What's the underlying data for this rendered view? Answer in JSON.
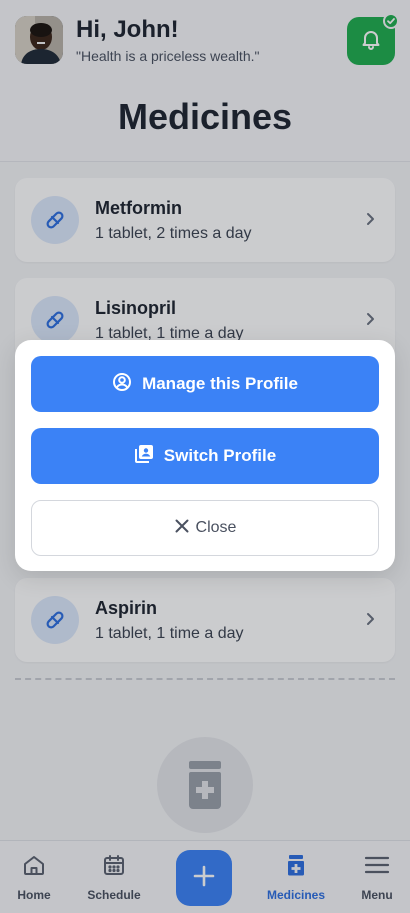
{
  "header": {
    "greeting": "Hi, John!",
    "quote": "\"Health is a priceless wealth.\"",
    "title": "Medicines"
  },
  "medicines": [
    {
      "name": "Metformin",
      "dose": "1 tablet, 2 times a day"
    },
    {
      "name": "Lisinopril",
      "dose": "1 tablet, 1 time a day"
    },
    {
      "name": "Aspirin",
      "dose": "1 tablet, 1 time a day"
    }
  ],
  "modal": {
    "manage_label": "Manage this Profile",
    "switch_label": "Switch Profile",
    "close_label": "Close"
  },
  "nav": {
    "home": "Home",
    "schedule": "Schedule",
    "medicines": "Medicines",
    "menu": "Menu"
  },
  "colors": {
    "accent": "#3b82f6",
    "bell_bg": "#1fae4f",
    "active_nav": "#2d6fe0"
  }
}
